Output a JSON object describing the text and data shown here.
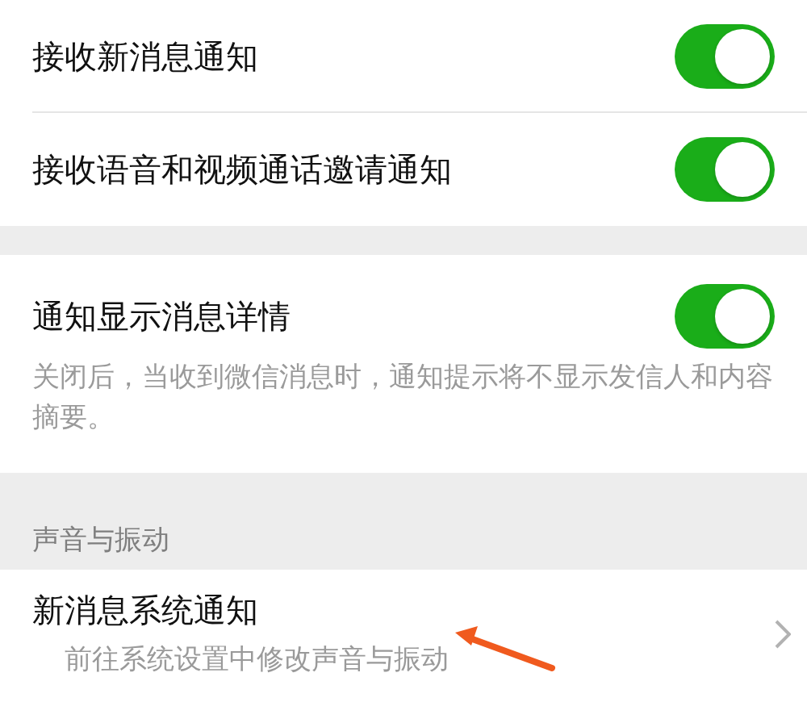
{
  "groups": [
    {
      "items": [
        {
          "kind": "toggle",
          "label": "接收新消息通知",
          "on": true
        },
        {
          "kind": "toggle",
          "label": "接收语音和视频通话邀请通知",
          "on": true
        }
      ]
    },
    {
      "items": [
        {
          "kind": "toggle",
          "label": "通知显示消息详情",
          "on": true,
          "description": "关闭后，当收到微信消息时，通知提示将不显示发信人和内容摘要。"
        }
      ]
    },
    {
      "header": "声音与振动",
      "items": [
        {
          "kind": "link",
          "label": "新消息系统通知",
          "description": "前往系统设置中修改声音与振动"
        }
      ]
    }
  ]
}
